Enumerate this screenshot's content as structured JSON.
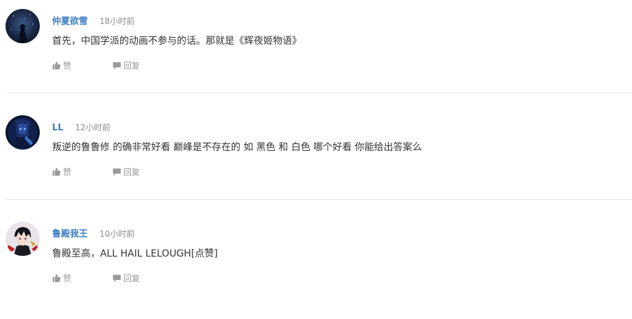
{
  "colors": {
    "username": "#3e7ec2",
    "time": "#8a8a8a",
    "text": "#333333",
    "action": "#999999",
    "divider": "#e5e5e5"
  },
  "comments": [
    {
      "avatar_icon": "avatar-night-sky",
      "username": "仲夏欲雪",
      "time": "18小时前",
      "content": "首先，中国学派的动画不参与的话。那就是《辉夜姬物语》",
      "like_icon": "thumbs-up-icon",
      "like_label": "赞",
      "reply_icon": "speech-bubble-icon",
      "reply_label": "回复"
    },
    {
      "avatar_icon": "avatar-anime-blue",
      "username": "LL",
      "time": "12小时前",
      "content": "叛逆的鲁鲁修 的确非常好看 巅峰是不存在的 如 黑色 和 白色 哪个好看 你能给出答案么",
      "like_icon": "thumbs-up-icon",
      "like_label": "赞",
      "reply_icon": "speech-bubble-icon",
      "reply_label": "回复"
    },
    {
      "avatar_icon": "avatar-lelouch",
      "username": "鲁殿我王",
      "time": "10小时前",
      "content": "鲁殿至高，ALL HAIL LELOUGH[点赞]",
      "like_icon": "thumbs-up-icon",
      "like_label": "赞",
      "reply_icon": "speech-bubble-icon",
      "reply_label": "回复"
    }
  ]
}
